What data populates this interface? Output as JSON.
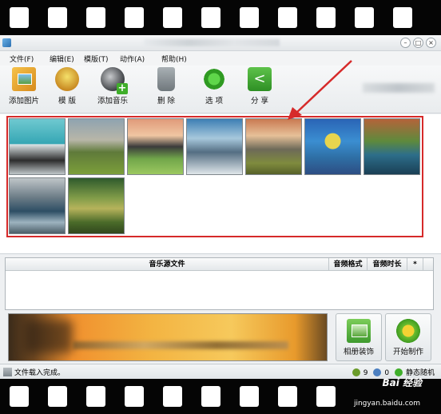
{
  "menu": {
    "items": [
      {
        "label": "文件(F)"
      },
      {
        "label": "编辑(E)"
      },
      {
        "label": "模版(T)"
      },
      {
        "label": "动作(A)"
      },
      {
        "label": "帮助(H)"
      }
    ]
  },
  "toolbar": {
    "add_image_label": "添加图片",
    "template_label": "模 版",
    "add_music_label": "添加音乐",
    "delete_label": "删 除",
    "options_label": "选 项",
    "share_label": "分 享"
  },
  "window": {
    "minimize_glyph": "–",
    "maximize_glyph": "□",
    "close_glyph": "×"
  },
  "images": {
    "count": 9
  },
  "music_table": {
    "columns": [
      "音乐源文件",
      "音频格式",
      "音频时长",
      "*"
    ],
    "rows": []
  },
  "actions": {
    "album_decor_label": "相册装饰",
    "start_making_label": "开始制作"
  },
  "status": {
    "message": "文件载入完成。",
    "count_a": "9",
    "count_b": "0",
    "mode": "静态随机"
  },
  "watermark": {
    "brand": "Bai 经验",
    "url": "jingyan.baidu.com"
  },
  "colors": {
    "highlight": "#d62a2a",
    "arrow": "#d62a2a"
  }
}
